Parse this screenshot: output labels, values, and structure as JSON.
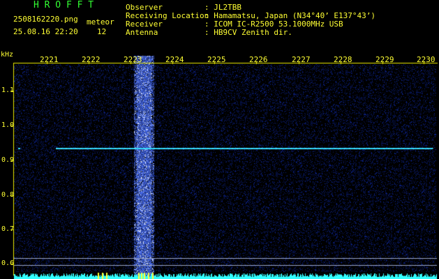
{
  "header": {
    "app_title": "H R O F F T",
    "filename": "2508162220.png",
    "datetime": "25.08.16 22:20",
    "meteor_label": "meteor",
    "meteor_count": "12",
    "info": [
      {
        "label": "Observer",
        "value": ": JL2TBB"
      },
      {
        "label": "Receiving Location",
        "value": ": Hamamatsu, Japan (N34°40’ E137°43’)"
      },
      {
        "label": "Receiver",
        "value": ": ICOM IC-R2500 53.1000MHz USB"
      },
      {
        "label": "Antenna",
        "value": ": HB9CV Zenith dir."
      }
    ]
  },
  "axes": {
    "y_unit": "kHz",
    "x_ticks": [
      "2221",
      "2222",
      "2223",
      "2224",
      "2225",
      "2226",
      "2227",
      "2228",
      "2229",
      "2230"
    ],
    "y_ticks": [
      "1.1",
      "1.0",
      "0.9",
      "0.8",
      "0.7",
      "0.6"
    ]
  },
  "colors": {
    "background": "#000000",
    "text_yellow": "#ffff33",
    "title_green": "#33ff33",
    "noise_blue": "#1a2a88",
    "signal_cyan": "#33ffff",
    "axis_yellow": "#e8e800"
  }
}
